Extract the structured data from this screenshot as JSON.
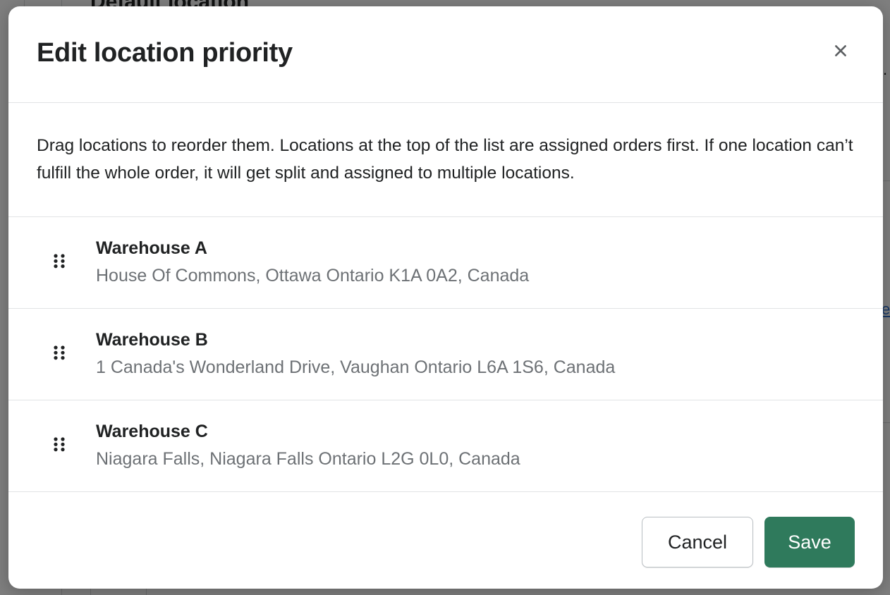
{
  "background": {
    "heading": "Default location",
    "link_fragment": "e",
    "trailing_dot": "."
  },
  "modal": {
    "title": "Edit location priority",
    "close_icon": "close-icon",
    "description": "Drag locations to reorder them. Locations at the top of the list are assigned orders first. If one location can’t fulfill the whole order, it will get split and assigned to multiple locations.",
    "locations": [
      {
        "name": "Warehouse A",
        "address": "House Of Commons, Ottawa Ontario K1A 0A2, Canada"
      },
      {
        "name": "Warehouse B",
        "address": "1 Canada's Wonderland Drive, Vaughan Ontario L6A 1S6, Canada"
      },
      {
        "name": "Warehouse C",
        "address": "Niagara Falls, Niagara Falls Ontario L2G 0L0, Canada"
      }
    ],
    "footer": {
      "cancel_label": "Cancel",
      "save_label": "Save"
    }
  },
  "colors": {
    "primary": "#2f7a5c",
    "overlay": "#000000",
    "secondary_text": "#6d7175",
    "border": "#e1e3e5"
  }
}
